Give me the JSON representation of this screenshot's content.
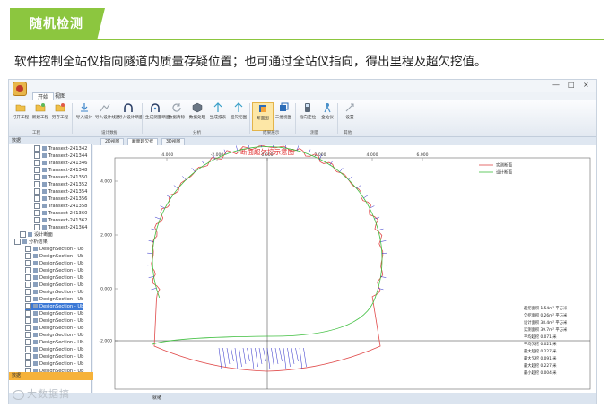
{
  "header": {
    "section_title": "随机检测",
    "description": "软件控制全站仪指向隧道内质量存疑位置；也可通过全站仪指向，得出里程及超欠挖值。",
    "accent_color": "#8cc63f"
  },
  "app": {
    "menu_tabs": [
      "开始",
      "视图"
    ],
    "window_controls": [
      "—",
      "□",
      "×"
    ],
    "ribbon_buttons": [
      {
        "label": "打开工程",
        "icon": "folder-icon"
      },
      {
        "label": "新建工程",
        "icon": "folder-new-icon"
      },
      {
        "label": "另存工程",
        "icon": "folder-save-icon"
      },
      {
        "label": "导入设计",
        "icon": "import-icon"
      },
      {
        "label": "导入设计线路",
        "icon": "route-icon"
      },
      {
        "label": "导入设计断面",
        "icon": "tunnel-section-icon"
      },
      {
        "label": "生成测量断面",
        "icon": "tunnel-measure-icon"
      },
      {
        "label": "数据清除",
        "icon": "refresh-icon"
      },
      {
        "label": "数据处理",
        "icon": "cube-icon"
      },
      {
        "label": "生成报表",
        "icon": "report-icon"
      },
      {
        "label": "超欠挖图",
        "icon": "chart-icon"
      },
      {
        "label": "断面图",
        "icon": "layers-icon"
      },
      {
        "label": "三维视图",
        "icon": "view3d-icon"
      },
      {
        "label": "指向定位",
        "icon": "locate-icon"
      },
      {
        "label": "全站仪",
        "icon": "instrument-icon"
      },
      {
        "label": "设置",
        "icon": "settings-icon"
      }
    ],
    "ribbon_groups": [
      "工程",
      "设计数据",
      "分析",
      "结果展示",
      "测量",
      "其他"
    ],
    "tree": {
      "transects": [
        "Transect-241342",
        "Transect-241344",
        "Transect-241346",
        "Transect-241348",
        "Transect-241350",
        "Transect-241352",
        "Transect-241354",
        "Transect-241356",
        "Transect-241358",
        "Transect-241360",
        "Transect-241362",
        "Transect-241364"
      ],
      "group_design": "设计断面",
      "group_analysis": "分析结果",
      "design_sections": [
        "DesignSection - Ub",
        "DesignSection - Ub",
        "DesignSection - Ub",
        "DesignSection - Ub",
        "DesignSection - Ub",
        "DesignSection - Ub",
        "DesignSection - Ub",
        "DesignSection - Ub",
        "DesignSection - Ub",
        "DesignSection - Ub",
        "DesignSection - Ub",
        "DesignSection - Ub",
        "DesignSection - Ub",
        "DesignSection - Ub",
        "DesignSection - Ub",
        "DesignSection - Ub",
        "DesignSection - Ub",
        "DesignSection - Ub"
      ],
      "footer": "数据"
    },
    "doc_tabs": [
      "2D视图",
      "断面超欠挖",
      "3D视图"
    ],
    "status_text": "就绪"
  },
  "chart_data": {
    "type": "line",
    "title": "断面超欠挖示意图",
    "x_ticks": [
      "-4.000",
      "-2.000",
      "0.000",
      "2.000",
      "4.000",
      "6.000"
    ],
    "y_ticks": [
      "4.000",
      "2.000",
      "0.000",
      "-2.000"
    ],
    "series": [
      {
        "name": "实测断面",
        "color": "#e04a4a"
      },
      {
        "name": "设计断面",
        "color": "#3fbf3f"
      }
    ],
    "stats": [
      "超挖面积 1.54m² 平方米",
      "欠挖面积 0.26m² 平方米",
      "设计面积 38.4m² 平方米",
      "实测面积 39.7m² 平方米",
      "平均超挖 0.071 米",
      "平均欠挖 0.021 米",
      "最大超挖 0.227 米",
      "最大欠挖 0.091 米",
      "最大超挖 0.227 米",
      "最小超挖 0.004 米"
    ],
    "label_color": "#3333cc"
  },
  "watermark": "大数据搞"
}
